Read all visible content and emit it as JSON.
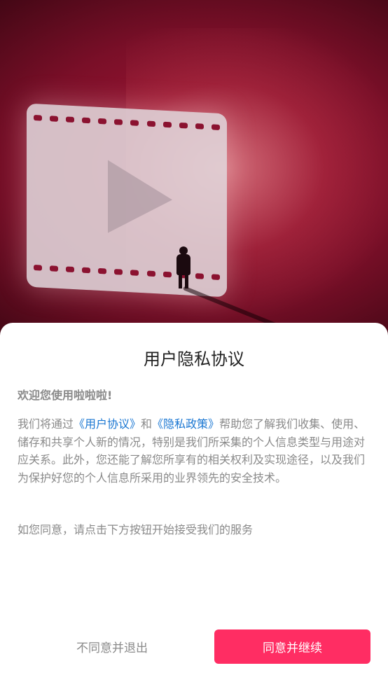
{
  "dialog": {
    "title": "用户隐私协议",
    "welcome": "欢迎您使用啦啦啦!",
    "intro_prefix": "我们将通过",
    "user_agreement_link": "《用户协议》",
    "conjunction": "和",
    "privacy_policy_link": "《隐私政策》",
    "intro_suffix": "帮助您了解我们收集、使用、储存和共享个人新的情况，特别是我们所采集的个人信息类型与用途对应关系。此外，您还能了解您所享有的相关权利及实现途径，以及我们为保护好您的个人信息所采用的业界领先的安全技术。",
    "consent_hint": "如您同意，请点击下方按钮开始接受我们的服务",
    "decline_button": "不同意并退出",
    "accept_button": "同意并继续"
  },
  "colors": {
    "accent": "#ff2d63",
    "link": "#1976d2",
    "text": "#8a8a8a",
    "title": "#222222"
  },
  "hero": {
    "icons": [
      "film-screen-icon",
      "play-icon",
      "person-silhouette-icon"
    ]
  }
}
